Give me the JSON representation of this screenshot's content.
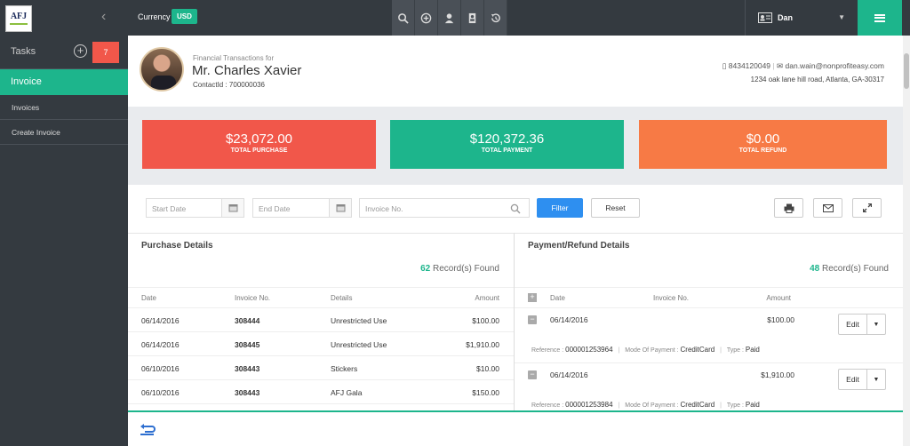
{
  "topbar": {
    "logo_text": "AFJ",
    "currency_label": "Currency",
    "currency_value": "USD",
    "tools": [
      "search-icon",
      "add-circle-icon",
      "user-icon",
      "contacts-icon",
      "history-icon"
    ],
    "user_name": "Dan"
  },
  "sidebar": {
    "tasks_label": "Tasks",
    "task_count": "7",
    "active_section": "Invoice",
    "items": [
      {
        "label": "Invoices"
      },
      {
        "label": "Create Invoice"
      }
    ]
  },
  "header": {
    "subtitle": "Financial Transactions for",
    "name": "Mr. Charles Xavier",
    "contact_id_label": "ContactId :",
    "contact_id": "700000036",
    "phone": "8434120049",
    "email": "dan.wain@nonprofiteasy.com",
    "address": "1234 oak lane hill road, Atlanta, GA-30317"
  },
  "cards": [
    {
      "amount": "$23,072.00",
      "label": "TOTAL PURCHASE",
      "color": "#f1574a"
    },
    {
      "amount": "$120,372.36",
      "label": "TOTAL PAYMENT",
      "color": "#1db58c"
    },
    {
      "amount": "$0.00",
      "label": "TOTAL REFUND",
      "color": "#f77a45"
    }
  ],
  "filter": {
    "start_placeholder": "Start Date",
    "end_placeholder": "End Date",
    "invoice_placeholder": "Invoice No.",
    "filter_label": "Filter",
    "reset_label": "Reset"
  },
  "purchase": {
    "title": "Purchase Details",
    "count": "62",
    "count_suffix": "Record(s) Found",
    "columns": [
      "Date",
      "Invoice No.",
      "Details",
      "Amount"
    ],
    "rows": [
      {
        "date": "06/14/2016",
        "invoice": "308444",
        "details": "Unrestricted Use",
        "amount": "$100.00"
      },
      {
        "date": "06/14/2016",
        "invoice": "308445",
        "details": "Unrestricted Use",
        "amount": "$1,910.00"
      },
      {
        "date": "06/10/2016",
        "invoice": "308443",
        "details": "Stickers",
        "amount": "$10.00"
      },
      {
        "date": "06/10/2016",
        "invoice": "308443",
        "details": "AFJ Gala",
        "amount": "$150.00"
      }
    ]
  },
  "payment": {
    "title": "Payment/Refund Details",
    "count": "48",
    "count_suffix": "Record(s) Found",
    "columns": [
      "Date",
      "Invoice No.",
      "Amount"
    ],
    "edit_label": "Edit",
    "reference_label": "Reference :",
    "mode_label": "Mode Of Payment :",
    "type_label": "Type :",
    "rows": [
      {
        "date": "06/14/2016",
        "amount": "$100.00",
        "reference": "000001253964",
        "mode": "CreditCard",
        "type": "Paid"
      },
      {
        "date": "06/14/2016",
        "amount": "$1,910.00",
        "reference": "000001253984",
        "mode": "CreditCard",
        "type": "Paid"
      }
    ]
  },
  "colors": {
    "accent": "#1db58c",
    "primary_button": "#2e8ff0",
    "topbar": "#343a40"
  }
}
